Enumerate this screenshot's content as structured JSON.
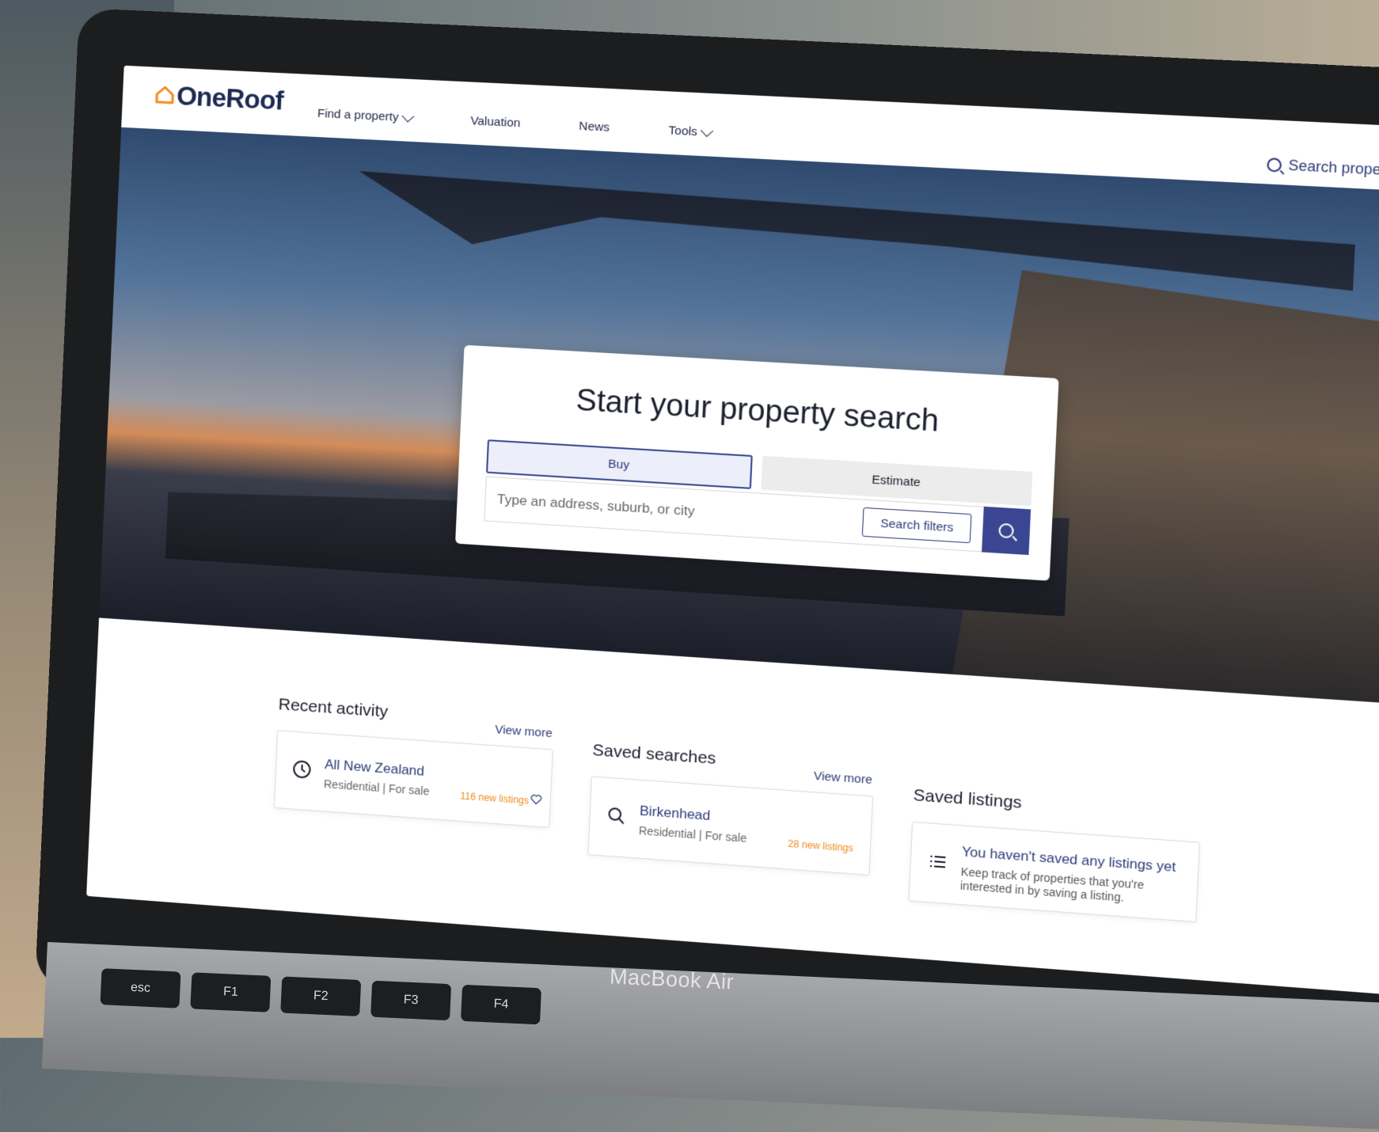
{
  "header": {
    "logo_text": "OneRoof",
    "nav": [
      {
        "label": "Find a property"
      },
      {
        "label": "Valuation"
      },
      {
        "label": "News"
      },
      {
        "label": "Tools"
      }
    ],
    "search_link": "Search properties"
  },
  "hero": {
    "title": "Start your property search",
    "tabs": [
      {
        "label": "Buy"
      },
      {
        "label": "Estimate"
      }
    ],
    "search_placeholder": "Type an address, suburb, or city",
    "filters_label": "Search filters"
  },
  "recent": {
    "title": "Recent activity",
    "view_more": "View more",
    "item": {
      "name": "All New Zealand",
      "sub": "Residential | For sale",
      "badge": "116 new listings"
    }
  },
  "saved_searches": {
    "title": "Saved searches",
    "view_more": "View more",
    "item": {
      "name": "Birkenhead",
      "sub": "Residential | For sale",
      "badge": "28 new listings"
    }
  },
  "saved_listings": {
    "title": "Saved listings",
    "empty_title": "You haven't saved any listings yet",
    "empty_sub": "Keep track of properties that you're interested in by saving a listing."
  },
  "device": {
    "brand": "MacBook Air",
    "keys": [
      "esc",
      "F1",
      "F2",
      "F3",
      "F4"
    ]
  },
  "colors": {
    "brand_navy": "#1d2a54",
    "accent": "#3a4692",
    "orange": "#f08a1c"
  }
}
